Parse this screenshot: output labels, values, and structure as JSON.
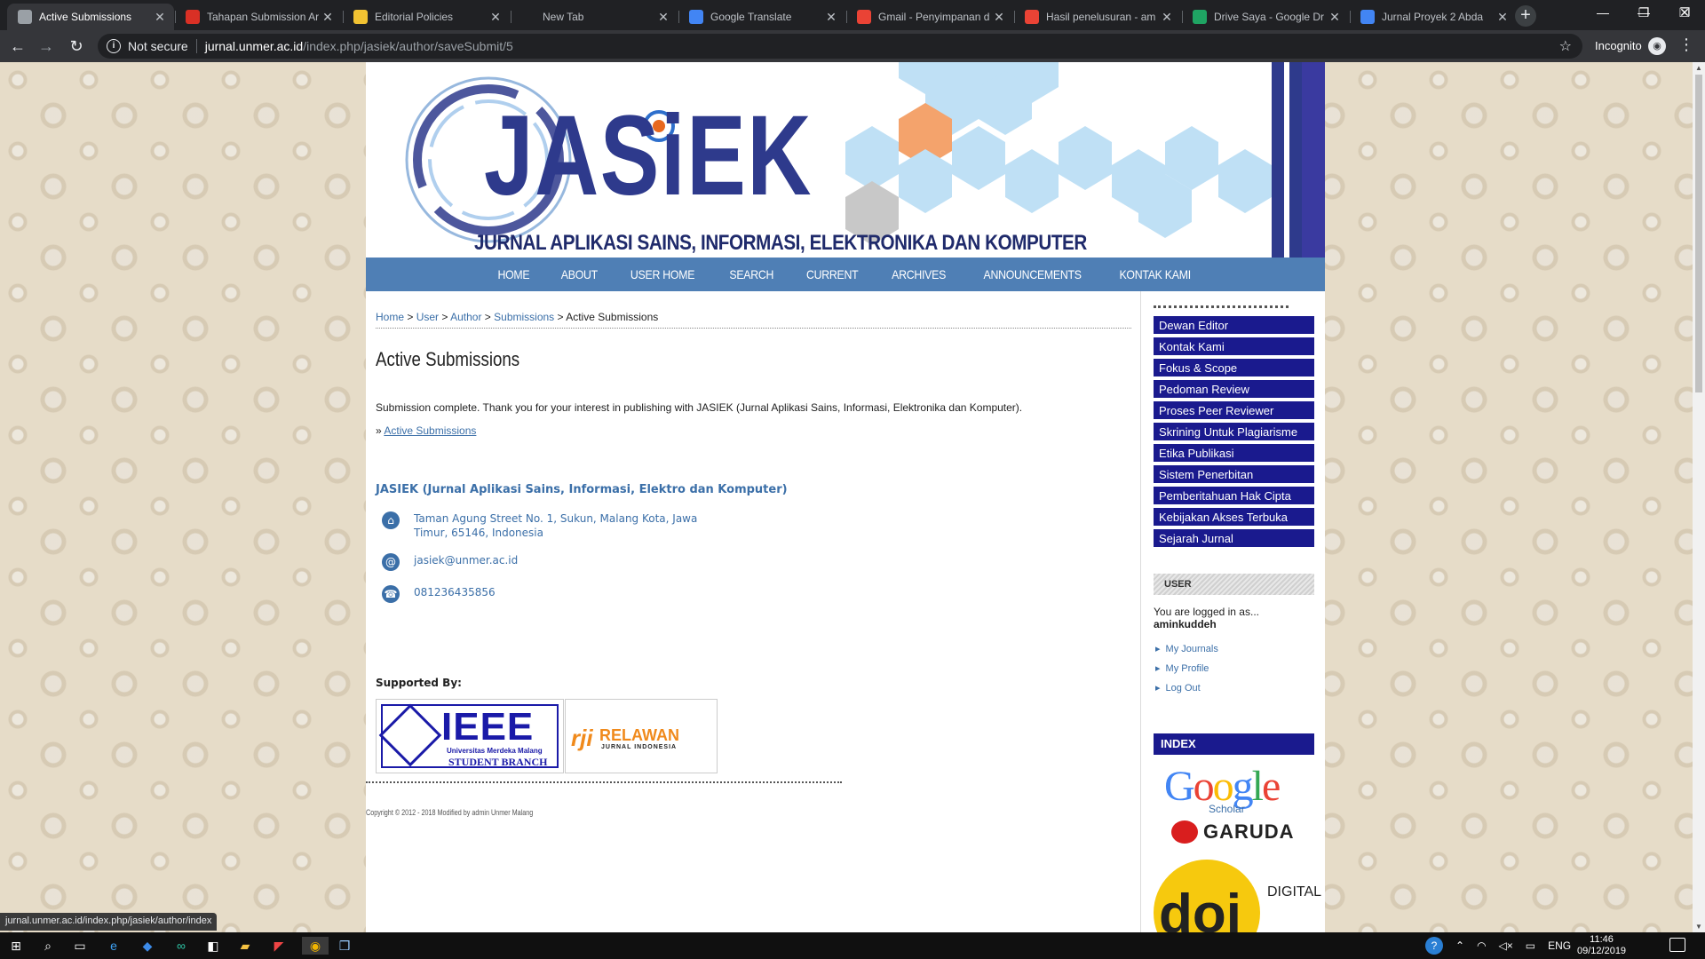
{
  "browser": {
    "tabs": [
      {
        "title": "Active Submissions",
        "favicon": "ojs-icon",
        "favcolor": "#9aa0a6",
        "active": true
      },
      {
        "title": "Tahapan Submission Ar",
        "favicon": "pdf-icon",
        "favcolor": "#d93025",
        "active": false
      },
      {
        "title": "Editorial Policies",
        "favicon": "ojs-icon",
        "favcolor": "#f1c232",
        "active": false
      },
      {
        "title": "New Tab",
        "favicon": "",
        "favcolor": "",
        "active": false
      },
      {
        "title": "Google Translate",
        "favicon": "translate-icon",
        "favcolor": "#4285f4",
        "active": false
      },
      {
        "title": "Gmail - Penyimpanan d",
        "favicon": "gmail-icon",
        "favcolor": "#ea4335",
        "active": false
      },
      {
        "title": "Hasil penelusuran - am",
        "favicon": "gmail-icon",
        "favcolor": "#ea4335",
        "active": false
      },
      {
        "title": "Drive Saya - Google Dr",
        "favicon": "drive-icon",
        "favcolor": "#1fa463",
        "active": false
      },
      {
        "title": "Jurnal Proyek 2 Abda",
        "favicon": "docs-icon",
        "favcolor": "#4285f4",
        "active": false
      }
    ],
    "security_label": "Not secure",
    "url_domain": "jurnal.unmer.ac.id",
    "url_path": "/index.php/jasiek/author/saveSubmit/5",
    "incognito_label": "Incognito",
    "status_url": "jurnal.unmer.ac.id/index.php/jasiek/author/index"
  },
  "site": {
    "logo_title": "JASiEK",
    "logo_subtitle": "JURNAL APLIKASI SAINS, INFORMASI, ELEKTRONIKA DAN KOMPUTER",
    "nav": [
      "HOME",
      "ABOUT",
      "USER HOME",
      "SEARCH",
      "CURRENT",
      "ARCHIVES",
      "ANNOUNCEMENTS",
      "KONTAK KAMI"
    ],
    "breadcrumb": {
      "home": "Home",
      "user": "User",
      "author": "Author",
      "submissions": "Submissions",
      "current": "Active Submissions",
      "sep": ">"
    },
    "page_title": "Active Submissions",
    "message": "Submission complete. Thank you for your interest in publishing with JASIEK (Jurnal Aplikasi Sains, Informasi, Elektronika dan Komputer).",
    "link_prefix": "»",
    "link_label": "Active Submissions",
    "contact": {
      "title": "JASIEK (Jurnal Aplikasi Sains, Informasi, Elektro dan Komputer)",
      "address_line1": "Taman Agung Street No. 1, Sukun, Malang Kota, Jawa",
      "address_line2": "Timur, 65146, Indonesia",
      "email": "jasiek@unmer.ac.id",
      "phone": "081236435856"
    },
    "supported_by": "Supported By:",
    "ieee": {
      "big": "IEEE",
      "line1": "Universitas Merdeka Malang",
      "line2": "STUDENT BRANCH"
    },
    "rji": {
      "mark": "rji",
      "name": "RELAWAN",
      "sub": "JURNAL INDONESIA"
    },
    "copyright": "Copyright © 2012 - 2018 Modified by admin Unmer Malang"
  },
  "sidebar": {
    "menu": [
      "Dewan Editor",
      "Kontak Kami",
      "Fokus & Scope",
      "Pedoman Review",
      "Proses Peer Reviewer",
      "Skrining Untuk Plagiarisme",
      "Etika Publikasi",
      "Sistem Penerbitan",
      "Pemberitahuan Hak Cipta",
      "Kebijakan Akses Terbuka",
      "Sejarah Jurnal"
    ],
    "user_heading": "USER",
    "logged_in_as": "You are logged in as...",
    "username": "aminkuddeh",
    "user_links": [
      "My Journals",
      "My Profile",
      "Log Out"
    ],
    "index_heading": "INDEX",
    "google_letters": [
      "G",
      "o",
      "o",
      "g",
      "l",
      "e"
    ],
    "google_colors": [
      "#4285f4",
      "#ea4335",
      "#fbbc05",
      "#4285f4",
      "#34a853",
      "#ea4335"
    ],
    "scholar": "Scholar",
    "garuda": "GARUDA",
    "doi": "doi",
    "digital": "DIGITAL"
  },
  "taskbar": {
    "lang": "ENG",
    "time": "11:46",
    "date": "09/12/2019"
  }
}
